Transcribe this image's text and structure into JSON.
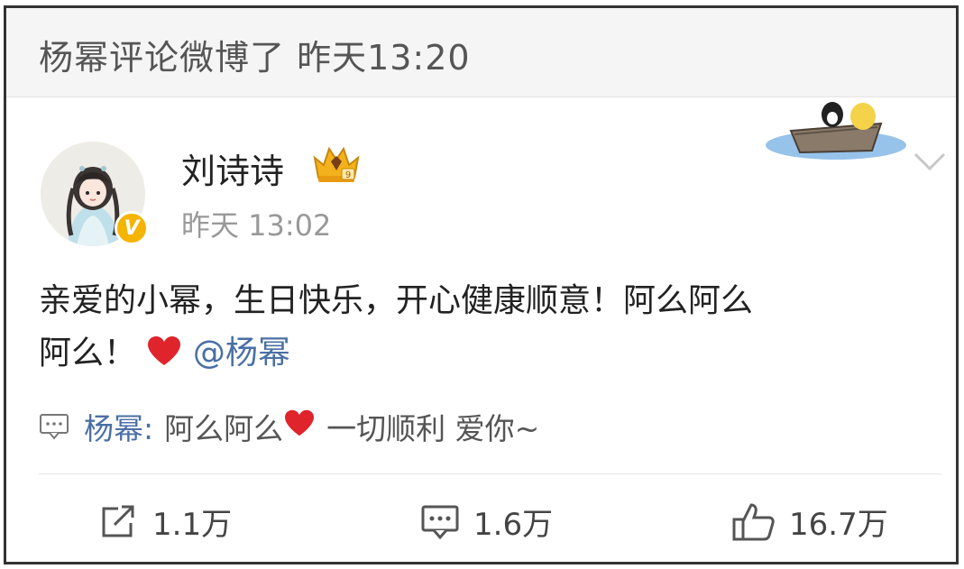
{
  "header": {
    "text": "杨幂评论微博了 昨天13:20"
  },
  "post": {
    "author": "刘诗诗",
    "time": "昨天 13:02",
    "content_line1": "亲爱的小幂，生日快乐，开心健康顺意！阿么阿么",
    "content_line2": "阿么！",
    "mention": "@杨幂",
    "badge_icon": "crown-vip-badge-icon",
    "verified_icon": "verified-v-icon"
  },
  "comment": {
    "author": "杨幂:",
    "text_part1": "阿么阿么",
    "text_part2": "一切顺利 爱你~"
  },
  "actions": {
    "repost": "1.1万",
    "comments": "1.6万",
    "likes": "16.7万"
  },
  "colors": {
    "link": "#4a6fa5",
    "heart": "#e0242c",
    "badge": "#f5b400"
  }
}
